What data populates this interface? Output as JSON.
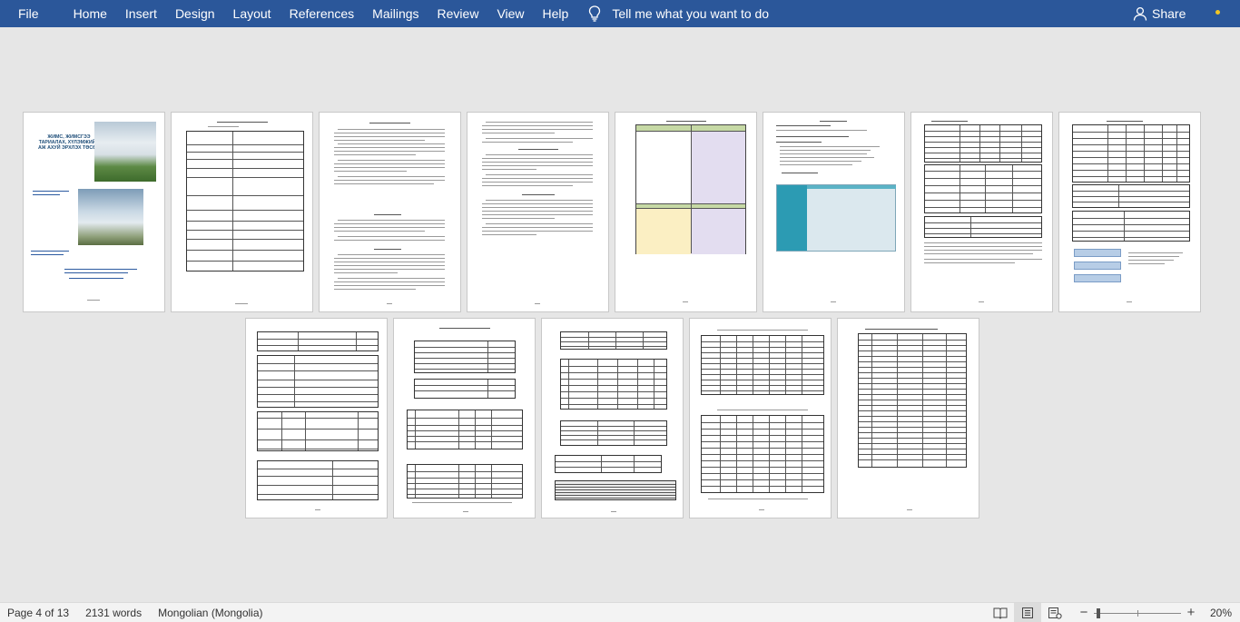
{
  "ribbon": {
    "tabs": [
      {
        "label": "File"
      },
      {
        "label": "Home"
      },
      {
        "label": "Insert"
      },
      {
        "label": "Design"
      },
      {
        "label": "Layout"
      },
      {
        "label": "References"
      },
      {
        "label": "Mailings"
      },
      {
        "label": "Review"
      },
      {
        "label": "View"
      },
      {
        "label": "Help"
      }
    ],
    "tell_me": "Tell me what you want to do",
    "share": "Share",
    "bulb_icon": "lightbulb-icon",
    "share_icon": "person-icon",
    "accent": "#2b579a",
    "notification_color": "#f3c623"
  },
  "cover": {
    "title": "ЖИМС, ЖИМСГЭЭ ТАРИАЛАХ, ХҮЛЭМЖИЙН АЖ АХУЙ ЭРХЛЭХ ТӨСӨЛ"
  },
  "status": {
    "page": "Page 4 of 13",
    "words": "2131 words",
    "language": "Mongolian (Mongolia)",
    "zoom": "20%",
    "view_icons": [
      "read-mode-icon",
      "print-layout-icon",
      "web-layout-icon"
    ],
    "zoom_level": 0.2
  }
}
